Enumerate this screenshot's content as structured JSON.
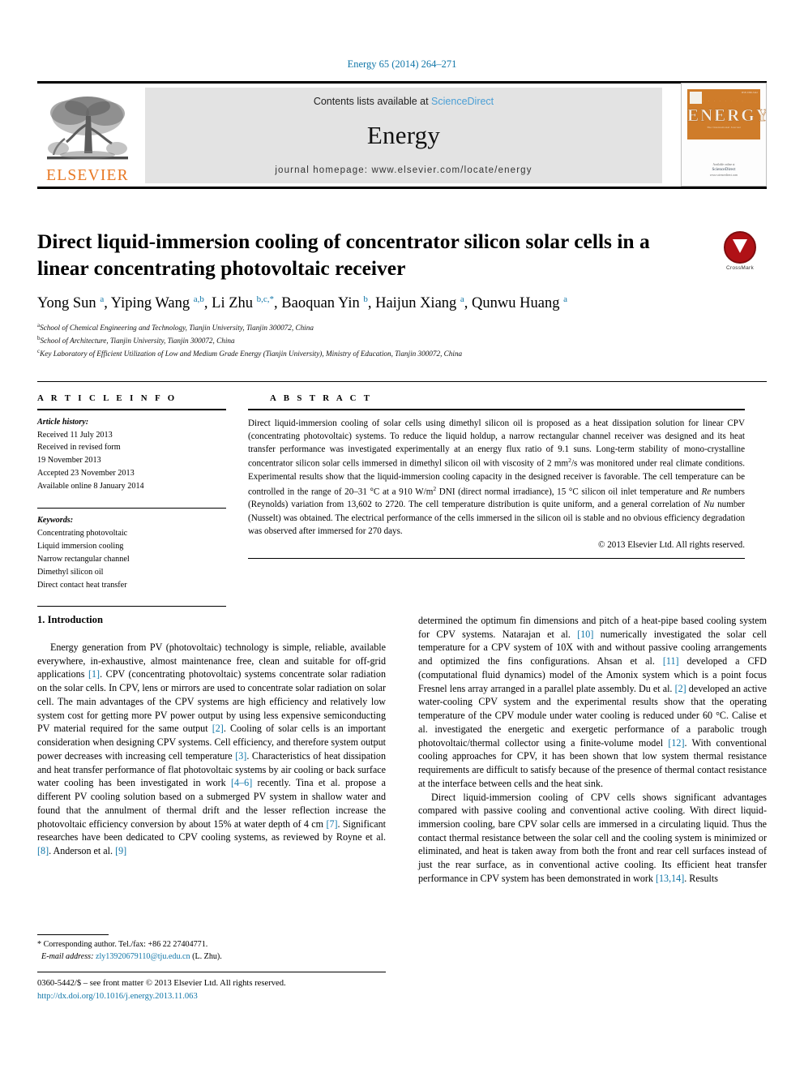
{
  "running_head": "Energy 65 (2014) 264–271",
  "masthead": {
    "contents_prefix": "Contents lists available at ",
    "sciencedirect": "ScienceDirect",
    "journal_name": "Energy",
    "homepage": "journal homepage: www.elsevier.com/locate/energy",
    "publisher_logo_text": "ELSEVIER",
    "cover": {
      "title": "ENERGY",
      "topline": "· · · · · · · ·",
      "botline": "· · · · · · · ·",
      "subtitle": "The International Journal",
      "issn": "ISSN 0360-5442",
      "foot_prefix": "Available online at",
      "foot_name": "ScienceDirect",
      "foot_url": "www.sciencedirect.com"
    }
  },
  "article": {
    "title": "Direct liquid-immersion cooling of concentrator silicon solar cells in a linear concentrating photovoltaic receiver",
    "crossmark_label": "CrossMark",
    "authors_html": "Yong Sun <sup>a</sup>, Yiping Wang <sup>a,b</sup>, Li Zhu <sup>b,c,</sup><sup>*</sup>, Baoquan Yin <sup>b</sup>, Haijun Xiang <sup>a</sup>, Qunwu Huang <sup>a</sup>",
    "affiliations": [
      {
        "mark": "a",
        "text": "School of Chemical Engineering and Technology, Tianjin University, Tianjin 300072, China"
      },
      {
        "mark": "b",
        "text": "School of Architecture, Tianjin University, Tianjin 300072, China"
      },
      {
        "mark": "c",
        "text": "Key Laboratory of Efficient Utilization of Low and Medium Grade Energy (Tianjin University), Ministry of Education, Tianjin 300072, China"
      }
    ]
  },
  "info": {
    "heading": "A R T I C L E   I N F O",
    "history_label": "Article history:",
    "history": [
      "Received 11 July 2013",
      "Received in revised form",
      "19 November 2013",
      "Accepted 23 November 2013",
      "Available online 8 January 2014"
    ],
    "keywords_label": "Keywords:",
    "keywords": [
      "Concentrating photovoltaic",
      "Liquid immersion cooling",
      "Narrow rectangular channel",
      "Dimethyl silicon oil",
      "Direct contact heat transfer"
    ]
  },
  "abstract": {
    "heading": "A B S T R A C T",
    "text_html": "Direct liquid-immersion cooling of solar cells using dimethyl silicon oil is proposed as a heat dissipation solution for linear CPV (concentrating photovoltaic) systems. To reduce the liquid holdup, a narrow rectangular channel receiver was designed and its heat transfer performance was investigated experimentally at an energy flux ratio of 9.1 suns. Long-term stability of mono-crystalline concentrator silicon solar cells immersed in dimethyl silicon oil with viscosity of 2 mm<sup>2</sup>/s was monitored under real climate conditions. Experimental results show that the liquid-immersion cooling capacity in the designed receiver is favorable. The cell temperature can be controlled in the range of 20–31 °C at a 910 W/m<sup>2</sup> DNI (direct normal irradiance), 15 °C silicon oil inlet temperature and <i>Re</i> numbers (Reynolds) variation from 13,602 to 2720. The cell temperature distribution is quite uniform, and a general correlation of <i>Nu</i> number (Nusselt) was obtained. The electrical performance of the cells immersed in the silicon oil is stable and no obvious efficiency degradation was observed after immersed for 270 days.",
    "copyright": "© 2013 Elsevier Ltd. All rights reserved."
  },
  "body": {
    "section1_heading": "1. Introduction",
    "left_paragraphs_html": [
      "Energy generation from PV (photovoltaic) technology is simple, reliable, available everywhere, in-exhaustive, almost maintenance free, clean and suitable for off-grid applications <span class=\"ref\">[1]</span>. CPV (concentrating photovoltaic) systems concentrate solar radiation on the solar cells. In CPV, lens or mirrors are used to concentrate solar radiation on solar cell. The main advantages of the CPV systems are high efficiency and relatively low system cost for getting more PV power output by using less expensive semiconducting PV material required for the same output <span class=\"ref\">[2]</span>. Cooling of solar cells is an important consideration when designing CPV systems. Cell efficiency, and therefore system output power decreases with increasing cell temperature <span class=\"ref\">[3]</span>. Characteristics of heat dissipation and heat transfer performance of flat photovoltaic systems by air cooling or back surface water cooling has been investigated in work <span class=\"ref\">[4–6]</span> recently. Tina et al. propose a different PV cooling solution based on a submerged PV system in shallow water and found that the annulment of thermal drift and the lesser reflection increase the photovoltaic efficiency conversion by about 15% at water depth of 4 cm <span class=\"ref\">[7]</span>. Significant researches have been dedicated to CPV cooling systems, as reviewed by Royne et al. <span class=\"ref\">[8]</span>. Anderson et al. <span class=\"ref\">[9]</span>"
    ],
    "right_paragraphs_html": [
      "determined the optimum fin dimensions and pitch of a heat-pipe based cooling system for CPV systems. Natarajan et al. <span class=\"ref\">[10]</span> numerically investigated the solar cell temperature for a CPV system of 10X with and without passive cooling arrangements and optimized the fins configurations. Ahsan et al. <span class=\"ref\">[11]</span> developed a CFD (computational fluid dynamics) model of the Amonix system which is a point focus Fresnel lens array arranged in a parallel plate assembly. Du et al. <span class=\"ref\">[2]</span> developed an active water-cooling CPV system and the experimental results show that the operating temperature of the CPV module under water cooling is reduced under 60 °C. Calise et al. investigated the energetic and exergetic performance of a parabolic trough photovoltaic/thermal collector using a finite-volume model <span class=\"ref\">[12]</span>. With conventional cooling approaches for CPV, it has been shown that low system thermal resistance requirements are difficult to satisfy because of the presence of thermal contact resistance at the interface between cells and the heat sink.",
      "Direct liquid-immersion cooling of CPV cells shows significant advantages compared with passive cooling and conventional active cooling. With direct liquid-immersion cooling, bare CPV solar cells are immersed in a circulating liquid. Thus the contact thermal resistance between the solar cell and the cooling system is minimized or eliminated, and heat is taken away from both the front and rear cell surfaces instead of just the rear surface, as in conventional active cooling. Its efficient heat transfer performance in CPV system has been demonstrated in work <span class=\"ref\">[13,14]</span>. Results"
    ]
  },
  "footnote": {
    "corresponding_html": "* Corresponding author. Tel./fax: +86 22 27404771.",
    "email_label": "E-mail address:",
    "email": "zly13920679110@tju.edu.cn",
    "email_suffix": "(L. Zhu)."
  },
  "bottom": {
    "issn_line": "0360-5442/$ – see front matter © 2013 Elsevier Ltd. All rights reserved.",
    "doi": "http://dx.doi.org/10.1016/j.energy.2013.11.063"
  },
  "colors": {
    "link": "#1176a8",
    "sciencedirect": "#4b9fd5",
    "elsevier_orange": "#E87722",
    "crossmark_red": "#b01116"
  }
}
